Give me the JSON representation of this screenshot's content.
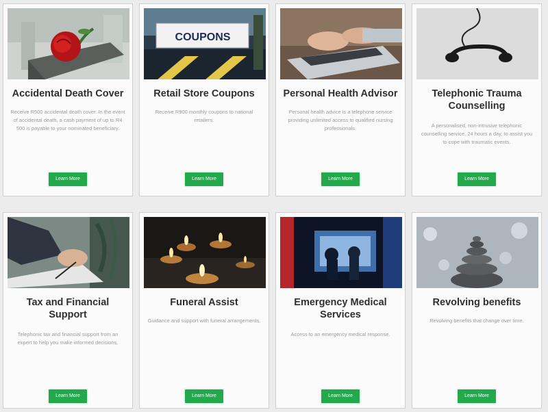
{
  "cards": [
    {
      "title": "Accidental Death Cover",
      "desc": "Receive R500 accidental death cover. In the event of accidental death, a cash payment of up to R4 500 is payable to your nominated beneficiary.",
      "button": "Learn More",
      "image_icon": "rose-icon"
    },
    {
      "title": "Retail Store Coupons",
      "desc": "Receive R900 monthly coupons to national retailers.",
      "button": "Learn More",
      "image_icon": "coupons-sign-icon",
      "image_text": "COUPONS"
    },
    {
      "title": "Personal Health Advisor",
      "desc": "Personal health advice is a telephone service providing unlimited access to qualified nursing professionals.",
      "button": "Learn More",
      "image_icon": "laptop-typing-icon"
    },
    {
      "title": "Telephonic Trauma Counselling",
      "desc": "A personalised, non-intrusive telephonic counselling service, 24 hours a day, to assist you to cope with traumatic events.",
      "button": "Learn More",
      "image_icon": "telephone-handset-icon"
    },
    {
      "title": "Tax and Financial Support",
      "desc": "Telephonic tax and financial support from an expert to help you make informed decisions.",
      "button": "Learn More",
      "image_icon": "signing-document-icon"
    },
    {
      "title": "Funeral Assist",
      "desc": "Guidance and support with funeral arrangements.",
      "button": "Learn More",
      "image_icon": "candles-icon"
    },
    {
      "title": "Emergency Medical Services",
      "desc": "Access to an emergency medical response.",
      "button": "Learn More",
      "image_icon": "ambulance-icon"
    },
    {
      "title": "Revolving benefits",
      "desc": "Revolving benefits that change over time.",
      "button": "Learn More",
      "image_icon": "stacked-stones-icon"
    }
  ],
  "colors": {
    "button": "#23a84b",
    "title": "#2f2f2f",
    "desc": "#9a9a9a",
    "card_bg": "#fbfbfb"
  }
}
